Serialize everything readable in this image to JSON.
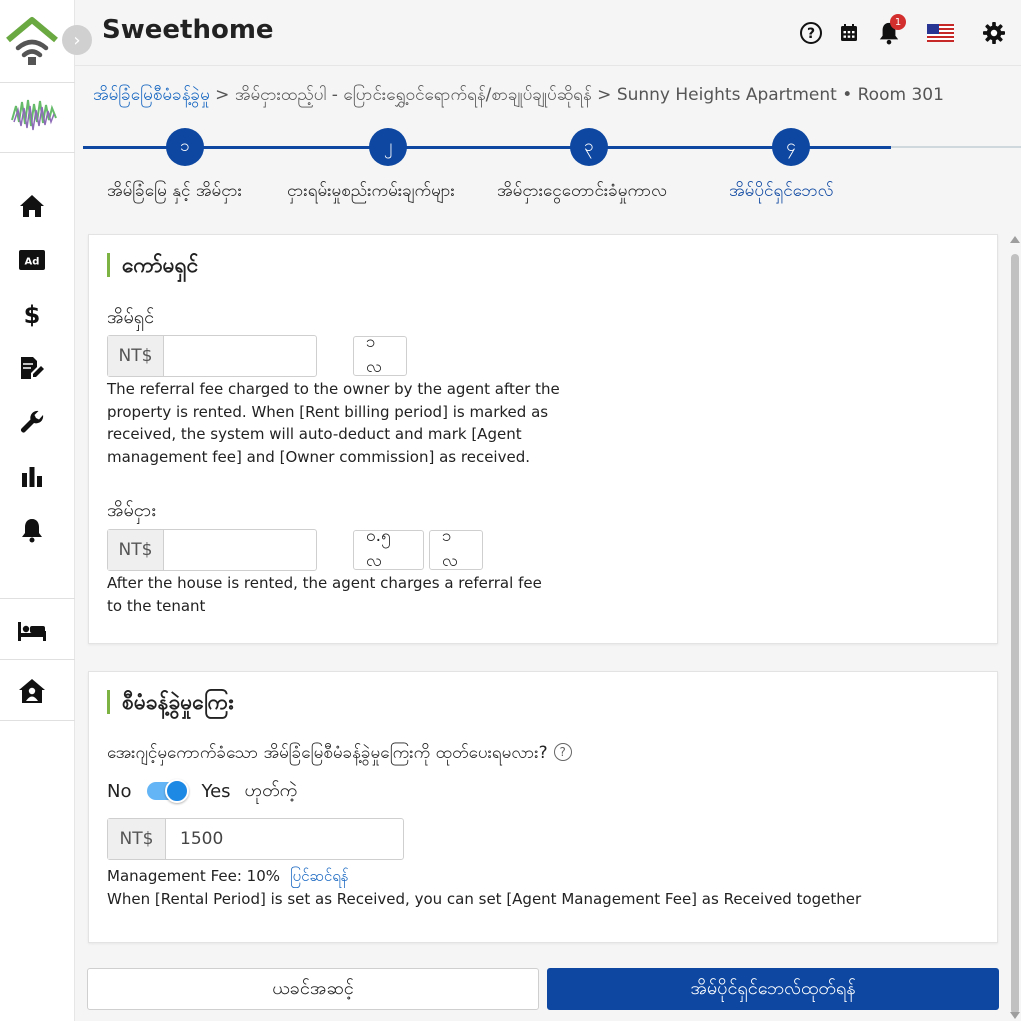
{
  "app": {
    "title": "Sweethome"
  },
  "header": {
    "notification_count": "1",
    "icons": [
      "help-circle-icon",
      "calendar-icon",
      "bell-icon",
      "us-flag-icon",
      "gear-icon"
    ]
  },
  "colors": {
    "primary": "#0d47a1",
    "accent_green": "#7cb342",
    "badge_red": "#d32f2f",
    "toggle_blue": "#1e88e5"
  },
  "sidebar": {
    "icons": [
      "home-icon",
      "ad-icon",
      "dollar-icon",
      "edit-document-icon",
      "wrench-icon",
      "bar-chart-icon",
      "bell-icon",
      "bed-icon",
      "house-user-icon"
    ]
  },
  "breadcrumb": {
    "root": "အိမ်ခြံမြေစီမံခန့်ခွဲမှု",
    "sep1": " > ",
    "step": "အိမ်ငှားထည့်ပါ",
    "sep2": "  - ",
    "sub": "ပြောင်းရွှေ့ဝင်ရောက်ရန်/စာချုပ်ချုပ်ဆိုရန်",
    "sep3": " > ",
    "property": "Sunny Heights Apartment • Room 301"
  },
  "stepper": {
    "steps": [
      {
        "number": "၁",
        "label": "အိမ်ခြံမြေ နှင့် အိမ်ငှား"
      },
      {
        "number": "၂",
        "label": "ငှားရမ်းမှုစည်းကမ်းချက်များ"
      },
      {
        "number": "၃",
        "label": "အိမ်ငှားငွေတောင်းခံမှုကာလ"
      },
      {
        "number": "၄",
        "label": "အိမ်ပိုင်ရှင်ဘေလ်"
      }
    ]
  },
  "commission": {
    "title": "ကော်မရှင်",
    "owner": {
      "label": "အိမ်ရှင်",
      "prefix": "NT$",
      "value": "",
      "chip": "၁ လ",
      "help": "The referral fee charged to the owner by the agent after the property is rented. When [Rent billing period] is marked as received, the system will auto-deduct and mark [Agent management fee] and [Owner commission] as received."
    },
    "tenant": {
      "label": "အိမ်ငှား",
      "prefix": "NT$",
      "value": "",
      "chip_half": "၀.၅ လ",
      "chip_one": "၁ လ",
      "help": "After the house is rented, the agent charges a referral fee to the tenant"
    }
  },
  "management": {
    "title": "စီမံခန့်ခွဲမှုကြေး",
    "question": "အေးဂျင့်မှကောက်ခံသော အိမ်ခြံမြေစီမံခန့်ခွဲမှုကြေးကို ထုတ်ပေးရမလား?",
    "toggle": {
      "off_label": "No",
      "on_label": "Yes",
      "extra_label": "ဟုတ်ကဲ့",
      "state": "on"
    },
    "fee": {
      "prefix": "NT$",
      "value": "1500"
    },
    "fee_note": "Management Fee: 10%",
    "edit_link": "ပြင်ဆင်ရန်",
    "note": "When [Rental Period] is set as Received, you can set [Agent Management Fee] as Received together"
  },
  "buttons": {
    "back": "ယခင်အဆင့်",
    "submit": "အိမ်ပိုင်ရှင်ဘေလ်ထုတ်ရန်"
  }
}
